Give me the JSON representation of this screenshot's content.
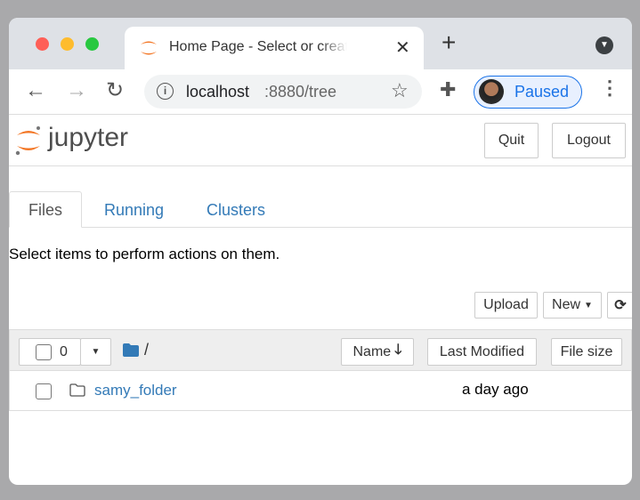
{
  "browser": {
    "tab_title": "Home Page - Select or create a notebook",
    "url_host": "localhost",
    "url_rest": ":8880/tree",
    "profile_label": "Paused"
  },
  "header": {
    "logo_text": "jupyter",
    "quit_label": "Quit",
    "logout_label": "Logout"
  },
  "tabs": [
    {
      "label": "Files",
      "active": true
    },
    {
      "label": "Running"
    },
    {
      "label": "Clusters"
    }
  ],
  "hint": "Select items to perform actions on them.",
  "actions": {
    "upload": "Upload",
    "new": "New"
  },
  "list_header": {
    "selected_count": "0",
    "path": "/",
    "name": "Name",
    "last_modified": "Last Modified",
    "file_size": "File size"
  },
  "items": [
    {
      "name": "samy_folder",
      "type": "folder",
      "modified": "a day ago"
    }
  ],
  "colors": {
    "link": "#337ab7",
    "accent": "#f37726",
    "profile": "#1a73e8"
  }
}
